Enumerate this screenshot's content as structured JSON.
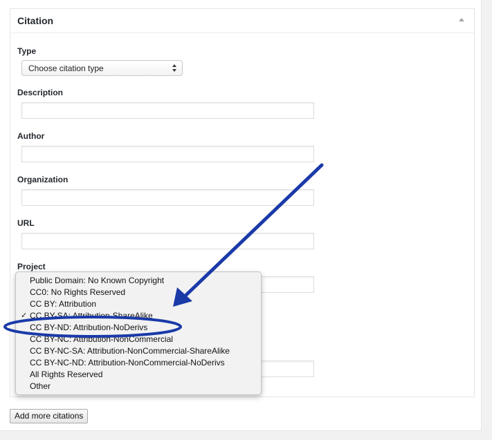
{
  "metabox": {
    "title": "Citation"
  },
  "fields": {
    "type_label": "Type",
    "type_select_value": "Choose citation type",
    "description_label": "Description",
    "author_label": "Author",
    "organization_label": "Organization",
    "url_label": "URL",
    "project_label": "Project"
  },
  "dropdown": {
    "selected_index": 3,
    "check_glyph": "✓",
    "options": [
      "Public Domain: No Known Copyright",
      "CC0: No Rights Reserved",
      "CC BY: Attribution",
      "CC BY-SA: Attribution-ShareAlike",
      "CC BY-ND: Attribution-NoDerivs",
      "CC BY-NC: Attribution-NonCommercial",
      "CC BY-NC-SA: Attribution-NonCommercial-ShareAlike",
      "CC BY-NC-ND: Attribution-NonCommercial-NoDerivs",
      "All Rights Reserved",
      "Other"
    ]
  },
  "buttons": {
    "add_more_label": "Add more citations"
  },
  "colors": {
    "annotation": "#1a3aa8"
  }
}
